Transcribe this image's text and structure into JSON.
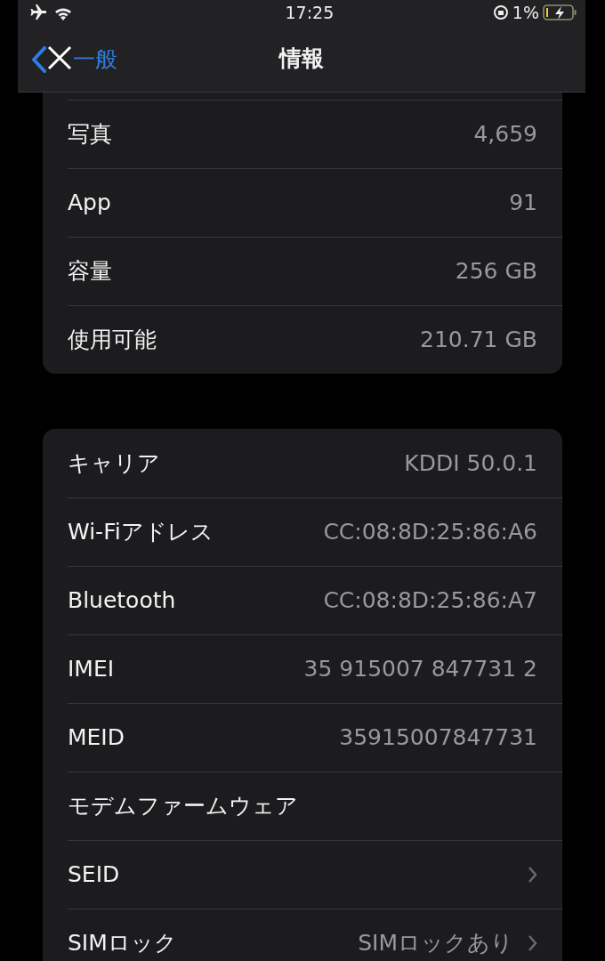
{
  "status_bar": {
    "time": "17:25",
    "battery_percent": "1%",
    "charging": true
  },
  "nav": {
    "back_label": "一般",
    "title": "情報"
  },
  "sections": [
    {
      "rows": [
        {
          "label": "写真",
          "value": "4,659",
          "disclosure": false
        },
        {
          "label": "App",
          "value": "91",
          "disclosure": false
        },
        {
          "label": "容量",
          "value": "256 GB",
          "disclosure": false
        },
        {
          "label": "使用可能",
          "value": "210.71 GB",
          "disclosure": false
        }
      ]
    },
    {
      "rows": [
        {
          "label": "キャリア",
          "value": "KDDI 50.0.1",
          "disclosure": false
        },
        {
          "label": "Wi-Fiアドレス",
          "value": "CC:08:8D:25:86:A6",
          "disclosure": false
        },
        {
          "label": "Bluetooth",
          "value": "CC:08:8D:25:86:A7",
          "disclosure": false
        },
        {
          "label": "IMEI",
          "value": "35 915007 847731 2",
          "disclosure": false
        },
        {
          "label": "MEID",
          "value": "35915007847731",
          "disclosure": false
        },
        {
          "label": "モデムファームウェア",
          "disclosure": false
        },
        {
          "label": "SEID",
          "disclosure": true
        },
        {
          "label": "SIMロック",
          "value": "SIMロックあり",
          "disclosure": true
        }
      ]
    }
  ]
}
